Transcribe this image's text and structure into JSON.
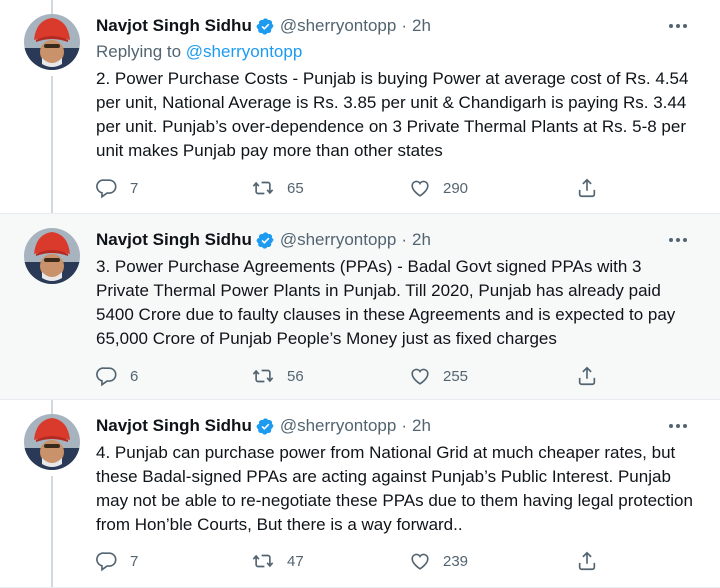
{
  "tweets": [
    {
      "name": "Navjot Singh Sidhu",
      "handle": "@sherryontopp",
      "separator": "·",
      "time": "2h",
      "reply_prefix": "Replying to",
      "reply_mention": "@sherryontopp",
      "text": "2. Power Purchase Costs - Punjab is buying Power at average cost of Rs. 4.54 per unit, National Average is Rs. 3.85 per unit & Chandigarh is paying Rs. 3.44 per unit. Punjab’s over-dependence on 3 Private Thermal Plants at Rs. 5-8 per unit makes Punjab pay more than other states",
      "replies": "7",
      "retweets": "65",
      "likes": "290"
    },
    {
      "name": "Navjot Singh Sidhu",
      "handle": "@sherryontopp",
      "separator": "·",
      "time": "2h",
      "text": "3. Power Purchase Agreements (PPAs) - Badal Govt signed PPAs with 3 Private Thermal Power Plants in Punjab. Till 2020, Punjab has already paid 5400 Crore due to faulty clauses in these Agreements and is expected to pay 65,000 Crore of Punjab People’s Money just as fixed charges",
      "replies": "6",
      "retweets": "56",
      "likes": "255"
    },
    {
      "name": "Navjot Singh Sidhu",
      "handle": "@sherryontopp",
      "separator": "·",
      "time": "2h",
      "text": "4. Punjab can purchase power from National Grid at much cheaper rates, but these Badal-signed PPAs are acting against Punjab’s Public Interest. Punjab may not be able to re-negotiate these PPAs due to them having legal protection from Hon’ble Courts, But there is a way forward..",
      "replies": "7",
      "retweets": "47",
      "likes": "239"
    }
  ],
  "colors": {
    "text": "#0f1419",
    "secondary": "#536471",
    "link": "#1d9bf0",
    "verified": "#1d9bf0",
    "thread_line": "#cfd9de",
    "highlight_bg": "#f7f9f9",
    "divider": "#e6ecf0"
  },
  "icons": {
    "verified": "verified-badge-icon",
    "more": "more-icon",
    "reply": "reply-icon",
    "retweet": "retweet-icon",
    "like": "like-icon",
    "share": "share-icon"
  }
}
